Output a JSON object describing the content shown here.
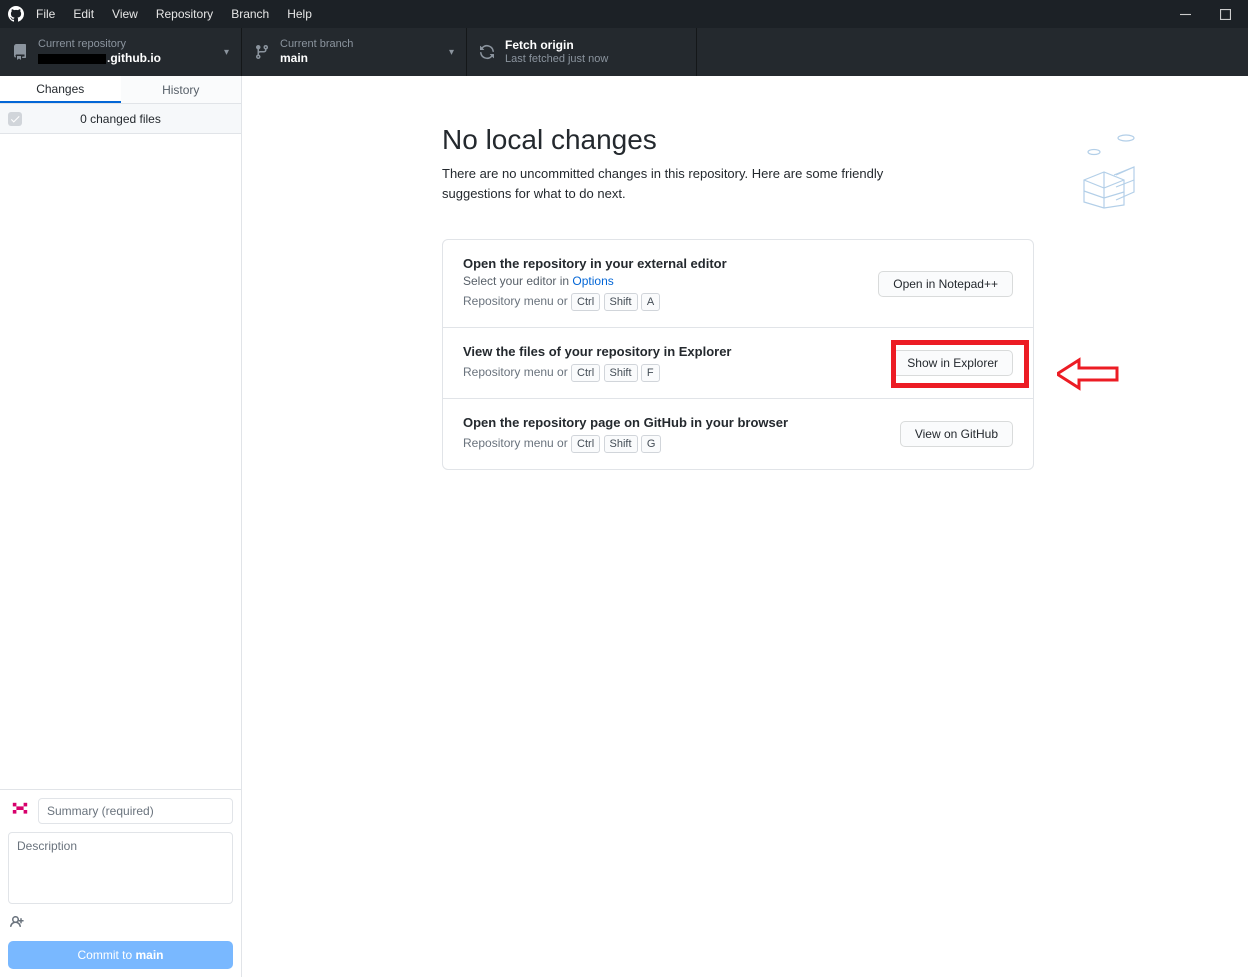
{
  "menu": {
    "items": [
      "File",
      "Edit",
      "View",
      "Repository",
      "Branch",
      "Help"
    ]
  },
  "toolbar": {
    "repo_label": "Current repository",
    "repo_value_suffix": ".github.io",
    "branch_label": "Current branch",
    "branch_value": "main",
    "fetch_label": "Fetch origin",
    "fetch_sub": "Last fetched just now"
  },
  "sidebar": {
    "tabs": {
      "changes": "Changes",
      "history": "History"
    },
    "changed_files": "0 changed files"
  },
  "commit": {
    "summary_placeholder": "Summary (required)",
    "desc_placeholder": "Description",
    "btn_prefix": "Commit to ",
    "btn_branch": "main"
  },
  "main": {
    "title": "No local changes",
    "subtitle": "There are no uncommitted changes in this repository. Here are some friendly suggestions for what to do next.",
    "cards": [
      {
        "title": "Open the repository in your external editor",
        "sub_prefix": "Select your editor in ",
        "sub_link": "Options",
        "hint_prefix": "Repository menu or ",
        "keys": [
          "Ctrl",
          "Shift",
          "A"
        ],
        "button": "Open in Notepad++"
      },
      {
        "title": "View the files of your repository in Explorer",
        "hint_prefix": "Repository menu or ",
        "keys": [
          "Ctrl",
          "Shift",
          "F"
        ],
        "button": "Show in Explorer"
      },
      {
        "title": "Open the repository page on GitHub in your browser",
        "hint_prefix": "Repository menu or ",
        "keys": [
          "Ctrl",
          "Shift",
          "G"
        ],
        "button": "View on GitHub"
      }
    ]
  }
}
